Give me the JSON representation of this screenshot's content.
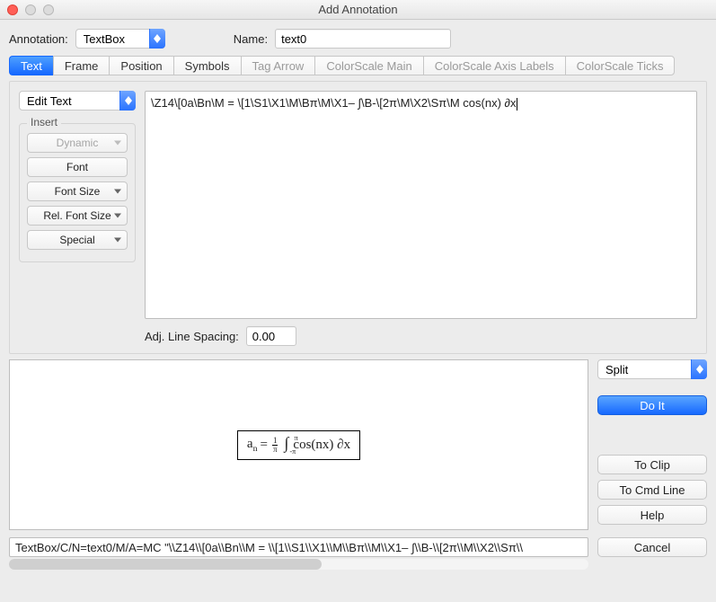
{
  "window": {
    "title": "Add Annotation"
  },
  "header": {
    "annotation_label": "Annotation:",
    "annotation_value": "TextBox",
    "name_label": "Name:",
    "name_value": "text0"
  },
  "tabs": {
    "items": [
      {
        "label": "Text",
        "selected": true,
        "inactive": false
      },
      {
        "label": "Frame",
        "selected": false,
        "inactive": false
      },
      {
        "label": "Position",
        "selected": false,
        "inactive": false
      },
      {
        "label": "Symbols",
        "selected": false,
        "inactive": false
      },
      {
        "label": "Tag Arrow",
        "selected": false,
        "inactive": true
      },
      {
        "label": "ColorScale Main",
        "selected": false,
        "inactive": true
      },
      {
        "label": "ColorScale Axis Labels",
        "selected": false,
        "inactive": true
      },
      {
        "label": "ColorScale Ticks",
        "selected": false,
        "inactive": true
      }
    ]
  },
  "edit": {
    "mode": "Edit Text",
    "text": "\\Z14\\[0a\\Bn\\M = \\[1\\S1\\X1\\M\\Bπ\\M\\X1– ∫\\B-\\[2π\\M\\X2\\Sπ\\M cos(nx) ∂x"
  },
  "insert": {
    "title": "Insert",
    "items": [
      {
        "label": "Dynamic",
        "disabled": true,
        "dropdown": true
      },
      {
        "label": "Font",
        "disabled": false,
        "dropdown": false
      },
      {
        "label": "Font Size",
        "disabled": false,
        "dropdown": true
      },
      {
        "label": "Rel. Font Size",
        "disabled": false,
        "dropdown": true
      },
      {
        "label": "Special",
        "disabled": false,
        "dropdown": true
      }
    ]
  },
  "spacing": {
    "label": "Adj. Line Spacing:",
    "value": "0.00"
  },
  "side": {
    "split": "Split",
    "doit": "Do It",
    "toclip": "To Clip",
    "tocmd": "To Cmd Line",
    "help": "Help",
    "cancel": "Cancel"
  },
  "formula": {
    "lhs_a": "a",
    "lhs_sub": "n",
    "eq": " = ",
    "frac_num": "1",
    "frac_den": "π",
    "int_ub": "π",
    "int_lb": "-π",
    "rhs": "cos(nx) ∂x"
  },
  "cmdline": "TextBox/C/N=text0/M/A=MC \"\\\\Z14\\\\[0a\\\\Bn\\\\M = \\\\[1\\\\S1\\\\X1\\\\M\\\\Bπ\\\\M\\\\X1– ∫\\\\B-\\\\[2π\\\\M\\\\X2\\\\Sπ\\\\"
}
